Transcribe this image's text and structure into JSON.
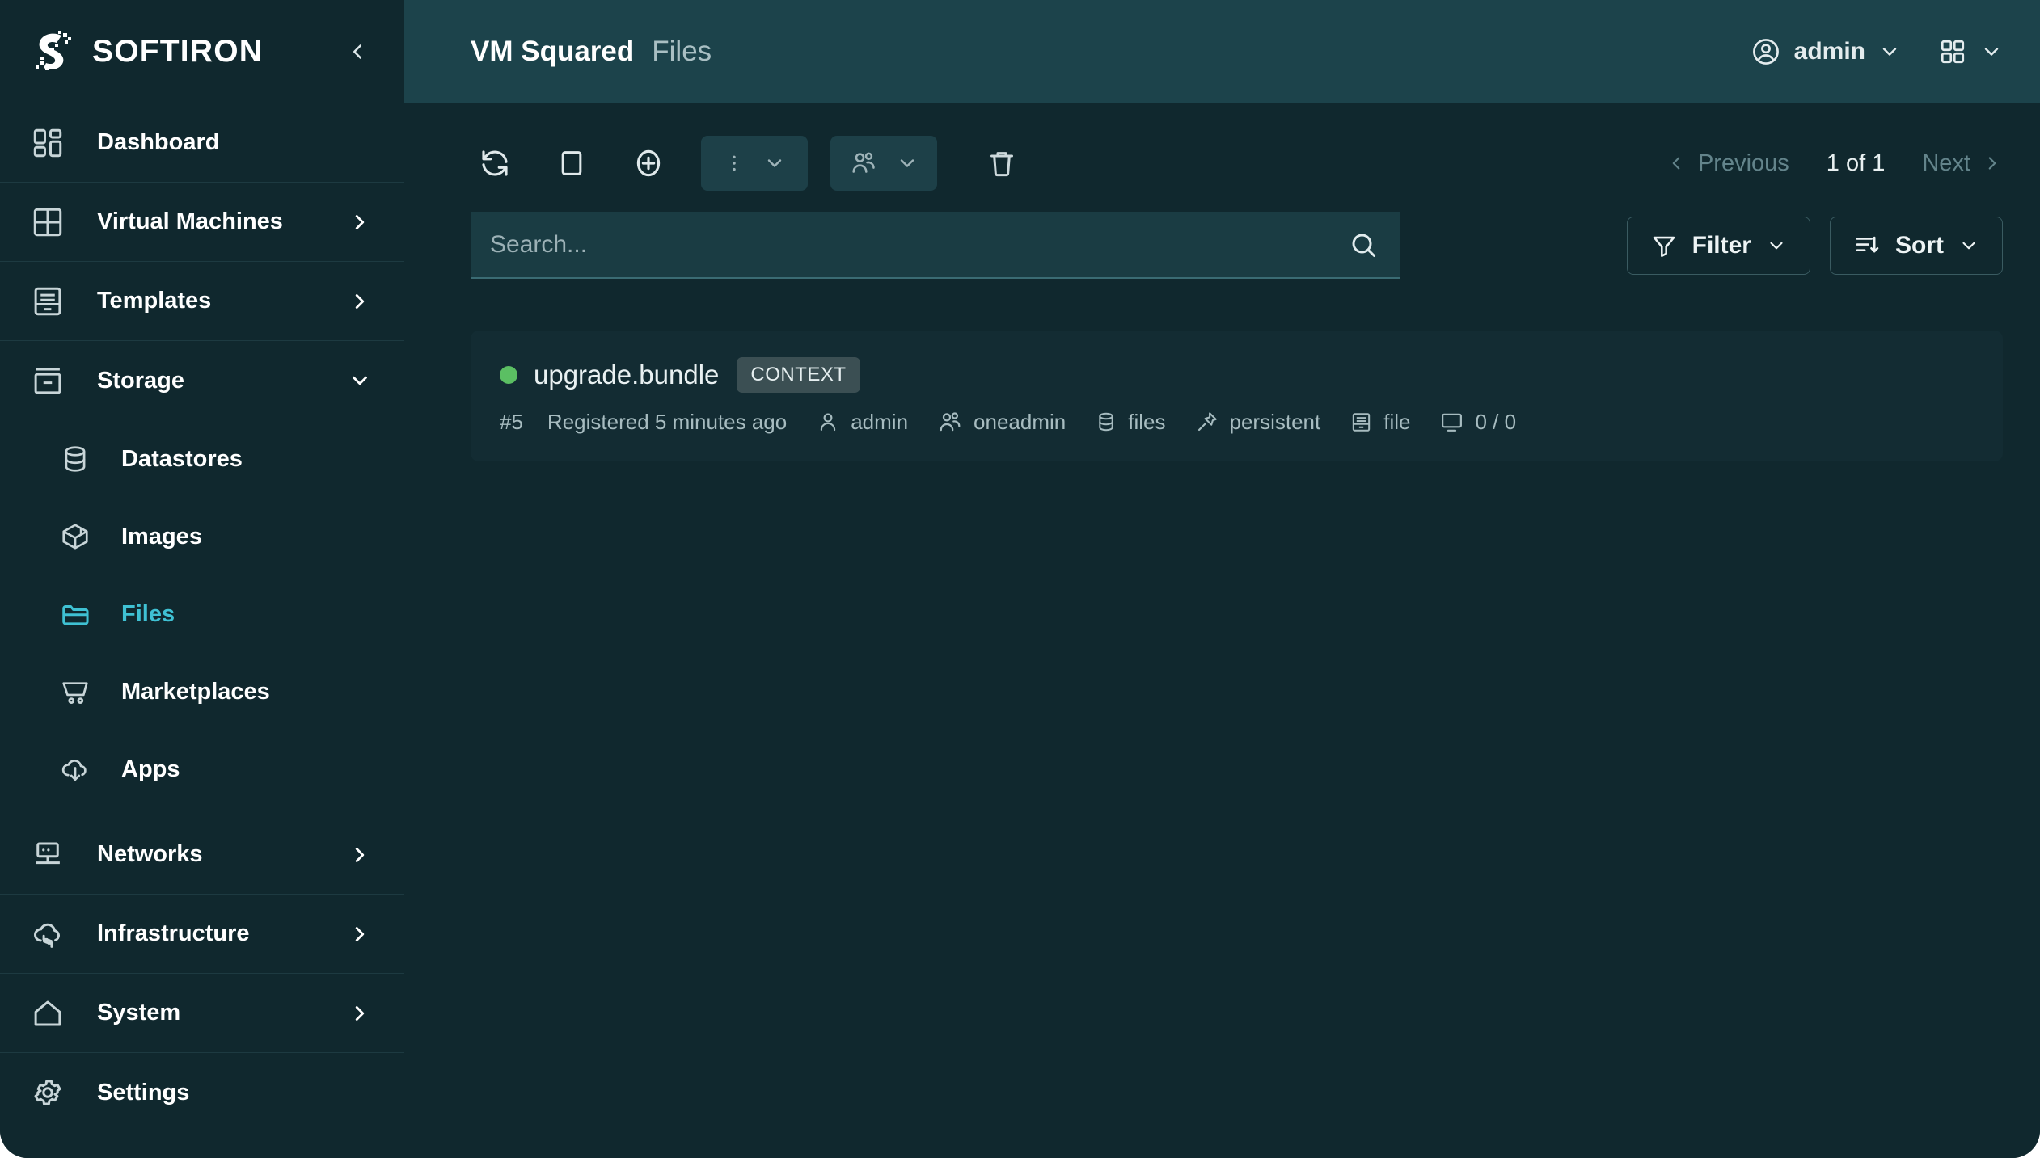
{
  "brand": {
    "name": "SOFTIRON",
    "logo_icon": "softiron-logo-icon",
    "collapse_icon": "chevron-left-icon"
  },
  "sidebar": {
    "items": [
      {
        "label": "Dashboard",
        "icon": "dashboard-grid-icon",
        "expandable": false
      },
      {
        "label": "Virtual Machines",
        "icon": "vm-grid-icon",
        "expandable": true,
        "chevron": "chevron-right-icon"
      },
      {
        "label": "Templates",
        "icon": "archive-drawer-icon",
        "expandable": true,
        "chevron": "chevron-right-icon"
      },
      {
        "label": "Storage",
        "icon": "storage-box-icon",
        "expandable": true,
        "expanded": true,
        "chevron": "chevron-down-icon"
      }
    ],
    "storage_children": [
      {
        "label": "Datastores",
        "icon": "database-icon",
        "active": false
      },
      {
        "label": "Images",
        "icon": "box-3d-icon",
        "active": false
      },
      {
        "label": "Files",
        "icon": "folder-icon",
        "active": true
      },
      {
        "label": "Marketplaces",
        "icon": "shopping-cart-icon",
        "active": false
      },
      {
        "label": "Apps",
        "icon": "cloud-download-icon",
        "active": false
      }
    ],
    "items_bottom": [
      {
        "label": "Networks",
        "icon": "network-monitor-icon",
        "expandable": true,
        "chevron": "chevron-right-icon"
      },
      {
        "label": "Infrastructure",
        "icon": "cloud-sync-icon",
        "expandable": true,
        "chevron": "chevron-right-icon"
      },
      {
        "label": "System",
        "icon": "home-icon",
        "expandable": true,
        "chevron": "chevron-right-icon"
      },
      {
        "label": "Settings",
        "icon": "gear-icon",
        "expandable": false
      }
    ]
  },
  "header": {
    "app_title": "VM Squared",
    "section": "Files",
    "user": "admin",
    "user_icon": "user-circle-icon",
    "user_chevron": "chevron-down-icon",
    "apps_grid_icon": "apps-grid-icon",
    "apps_chevron": "chevron-down-icon"
  },
  "toolbar": {
    "refresh_icon": "refresh-icon",
    "select_all_icon": "checkbox-square-icon",
    "add_icon": "plus-circle-icon",
    "more_icon": "vertical-dots-icon",
    "more_chevron": "chevron-down-icon",
    "ownership_icon": "users-group-icon",
    "ownership_chevron": "chevron-down-icon",
    "delete_icon": "trash-icon"
  },
  "pagination": {
    "previous_label": "Previous",
    "previous_icon": "chevron-left-icon",
    "page_status": "1 of 1",
    "next_label": "Next",
    "next_icon": "chevron-right-icon"
  },
  "search": {
    "placeholder": "Search...",
    "value": "",
    "icon": "search-icon"
  },
  "controls": {
    "filter_label": "Filter",
    "filter_icon": "funnel-icon",
    "filter_chevron": "chevron-down-icon",
    "sort_label": "Sort",
    "sort_icon": "sort-descending-icon",
    "sort_chevron": "chevron-down-icon"
  },
  "list": {
    "items": [
      {
        "status": "active",
        "status_color": "#5BBF63",
        "name": "upgrade.bundle",
        "badge": "CONTEXT",
        "id": "#5",
        "registered": "Registered 5 minutes ago",
        "owner": "admin",
        "owner_icon": "user-icon",
        "group": "oneadmin",
        "group_icon": "users-group-icon",
        "datastore": "files",
        "datastore_icon": "database-icon",
        "persistence": "persistent",
        "persistence_icon": "pin-icon",
        "type": "file",
        "type_icon": "archive-drawer-icon",
        "vms": "0 / 0",
        "vms_icon": "monitor-icon"
      }
    ]
  },
  "colors": {
    "sidebar_bg": "#10282E",
    "header_bg": "#1C434B",
    "main_bg": "#10282E",
    "card_bg": "#132C33",
    "accent": "#3FC1D3",
    "status_green": "#5BBF63"
  }
}
